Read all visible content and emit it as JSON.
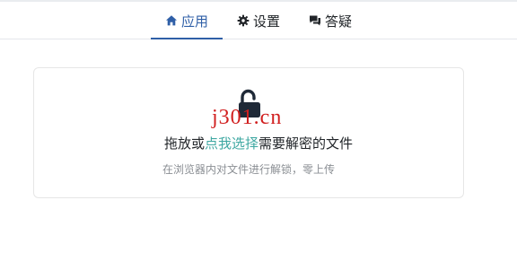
{
  "nav": {
    "tabs": [
      {
        "label": "应用",
        "icon": "home-icon",
        "active": true
      },
      {
        "label": "设置",
        "icon": "gear-icon",
        "active": false
      },
      {
        "label": "答疑",
        "icon": "chat-icon",
        "active": false
      }
    ]
  },
  "dropzone": {
    "icon": "unlock-icon",
    "text_before": "拖放或",
    "link_text": "点我选择",
    "text_after": "需要解密的文件",
    "subtitle": "在浏览器内对文件进行解锁，零上传"
  },
  "watermark": {
    "text": "j301.cn"
  },
  "colors": {
    "accent": "#2f5fa7",
    "link": "#3fa8a2",
    "watermark": "#d11f1f",
    "muted_text": "#8b8f94",
    "icon_dark": "#1f2937"
  }
}
